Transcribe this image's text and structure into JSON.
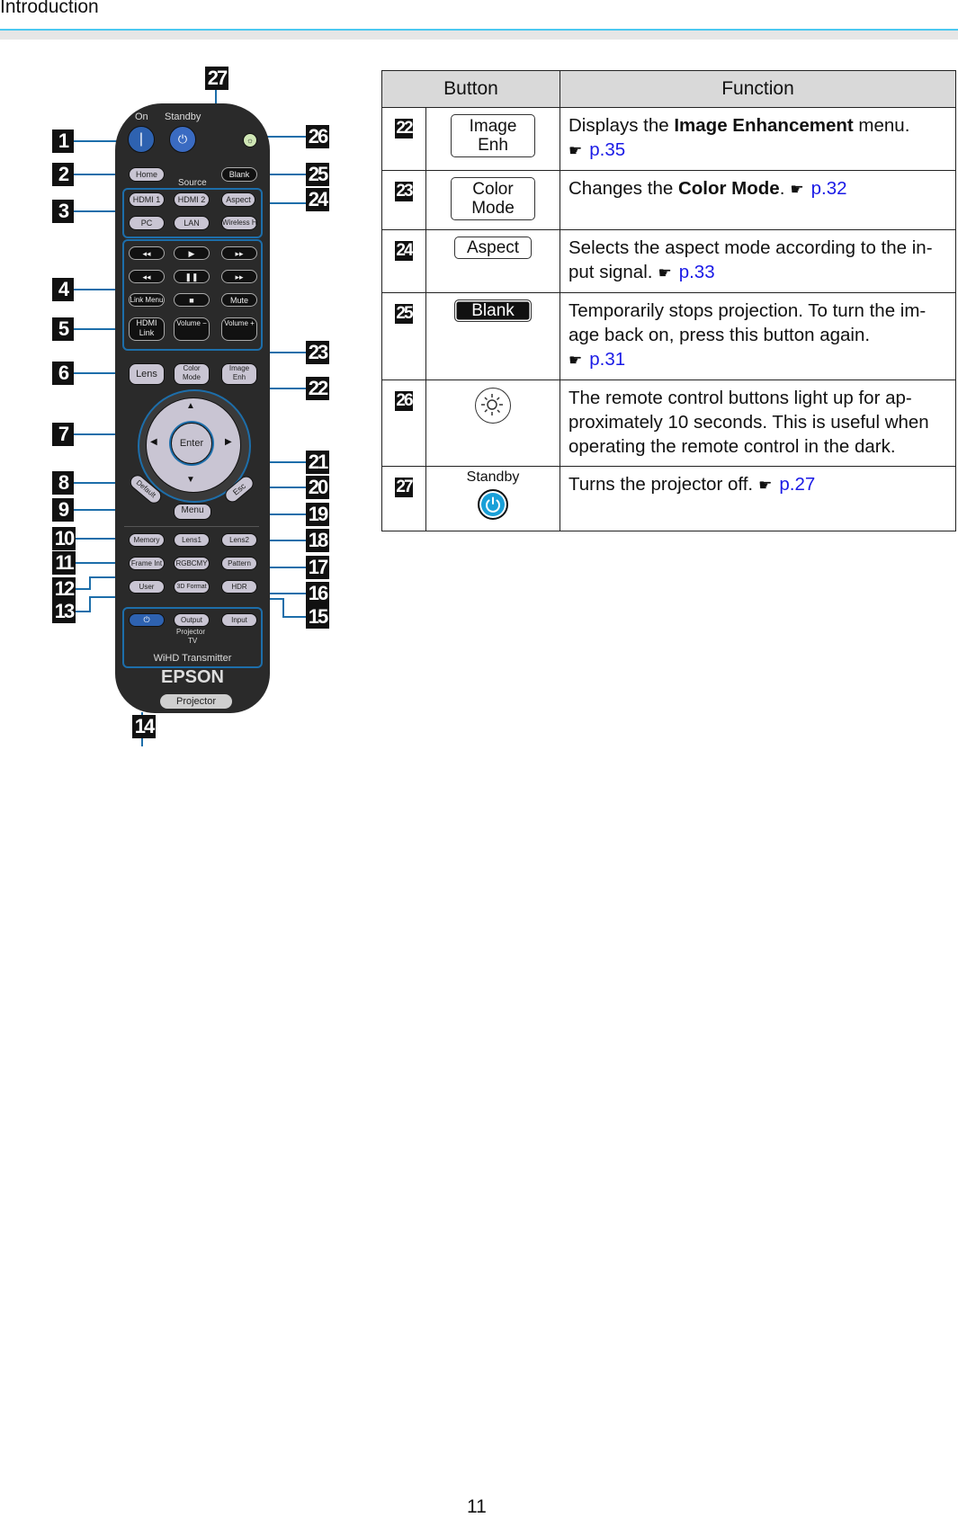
{
  "header": {
    "section_title": "Introduction"
  },
  "page_number": "11",
  "remote": {
    "labels": {
      "on": "On",
      "standby": "Standby",
      "source": "Source",
      "wihd_transmitter": "WiHD Transmitter",
      "projector_tv": "Projector",
      "tv": "TV",
      "brand": "EPSON",
      "projector_pill": "Projector"
    },
    "buttons": {
      "home": "Home",
      "blank": "Blank",
      "hdmi1": "HDMI 1",
      "hdmi2": "HDMI 2",
      "aspect": "Aspect",
      "pc": "PC",
      "lan": "LAN",
      "wireless_hd": "Wireless HD",
      "rewind": "◂◂",
      "play": "▶",
      "fast_forward": "▸▸",
      "prev": "◂◂",
      "pause": "❚❚",
      "next": "▸▸",
      "link_menu": "Link Menu",
      "stop": "■",
      "mute": "Mute",
      "hdmi_link": "HDMI Link",
      "volume_down": "Volume −",
      "volume_up": "Volume +",
      "lens": "Lens",
      "color_mode": "Color Mode",
      "image_enh": "Image Enh",
      "up": "▲",
      "down": "▼",
      "left": "◀",
      "right": "▶",
      "enter": "Enter",
      "default": "Default",
      "menu": "Menu",
      "esc": "Esc",
      "memory": "Memory",
      "lens1": "Lens1",
      "lens2": "Lens2",
      "frame_int": "Frame Int",
      "rgbcmy": "RGBCMY",
      "pattern": "Pattern",
      "user": "User",
      "format_3d": "3D Format",
      "hdr": "HDR",
      "wihd_power": "⏻",
      "output": "Output",
      "input": "Input"
    },
    "callouts": [
      "1",
      "2",
      "3",
      "4",
      "5",
      "6",
      "7",
      "8",
      "9",
      "10",
      "11",
      "12",
      "13",
      "14",
      "15",
      "16",
      "17",
      "18",
      "19",
      "20",
      "21",
      "22",
      "23",
      "24",
      "25",
      "26",
      "27"
    ],
    "highlight_color": "#1d6eaa"
  },
  "table": {
    "headers": {
      "button": "Button",
      "function": "Function"
    },
    "rows": [
      {
        "num": "22",
        "button_label": "Image Enh",
        "button_line1": "Image",
        "button_line2": "Enh",
        "text_before": "Displays the ",
        "bold": "Image Enhancement",
        "text_after": " menu.",
        "ref": "p.35"
      },
      {
        "num": "23",
        "button_label": "Color Mode",
        "button_line1": "Color",
        "button_line2": "Mode",
        "text_before": "Changes the ",
        "bold": "Color Mode",
        "text_after": ".",
        "ref": "p.32"
      },
      {
        "num": "24",
        "button_label": "Aspect",
        "text_before": "Selects the aspect mode according to the in-put signal.",
        "bold": "",
        "text_after": "",
        "ref": "p.33"
      },
      {
        "num": "25",
        "button_label": "Blank",
        "text_before": "Temporarily stops projection. To turn the im-age back on, press this button again.",
        "bold": "",
        "text_after": "",
        "ref": "p.31"
      },
      {
        "num": "26",
        "button_label": "illumination",
        "text_before": "The remote control buttons light up for ap-proximately 10 seconds. This is useful when operating the remote control in the dark.",
        "bold": "",
        "text_after": "",
        "ref": ""
      },
      {
        "num": "27",
        "button_label": "Standby",
        "text_before": "Turns the projector off.",
        "bold": "",
        "text_after": "",
        "ref": "p.27"
      }
    ],
    "ref_color": "#1a1ae6",
    "hand_icon": "☛"
  }
}
